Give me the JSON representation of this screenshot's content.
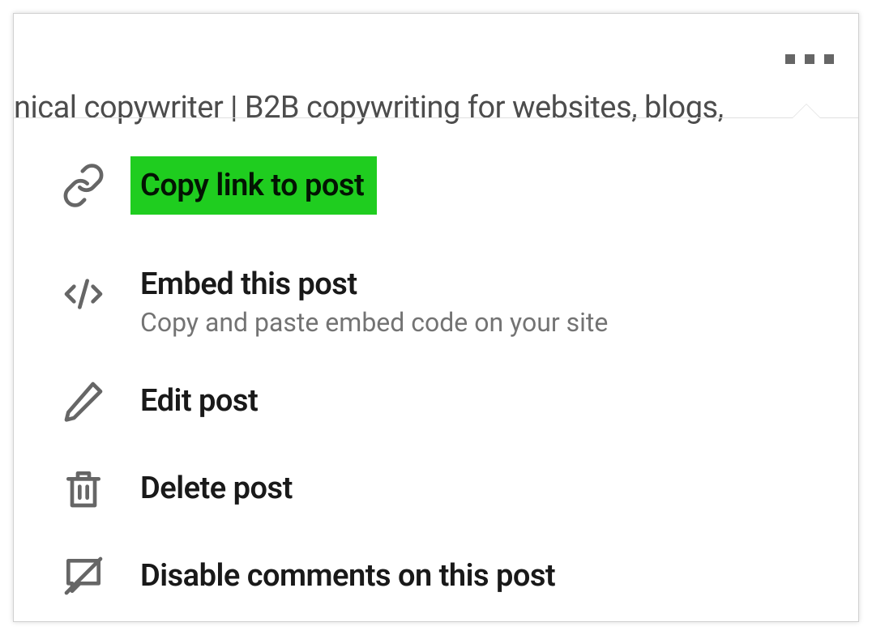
{
  "header": {
    "partial_text": "nical copywriter | B2B copywriting for websites, blogs,"
  },
  "menu": {
    "items": [
      {
        "label": "Copy link to post",
        "highlighted": true
      },
      {
        "label": "Embed this post",
        "sub_label": "Copy and paste embed code on your site"
      },
      {
        "label": "Edit post"
      },
      {
        "label": "Delete post"
      },
      {
        "label": "Disable comments on this post"
      }
    ]
  }
}
